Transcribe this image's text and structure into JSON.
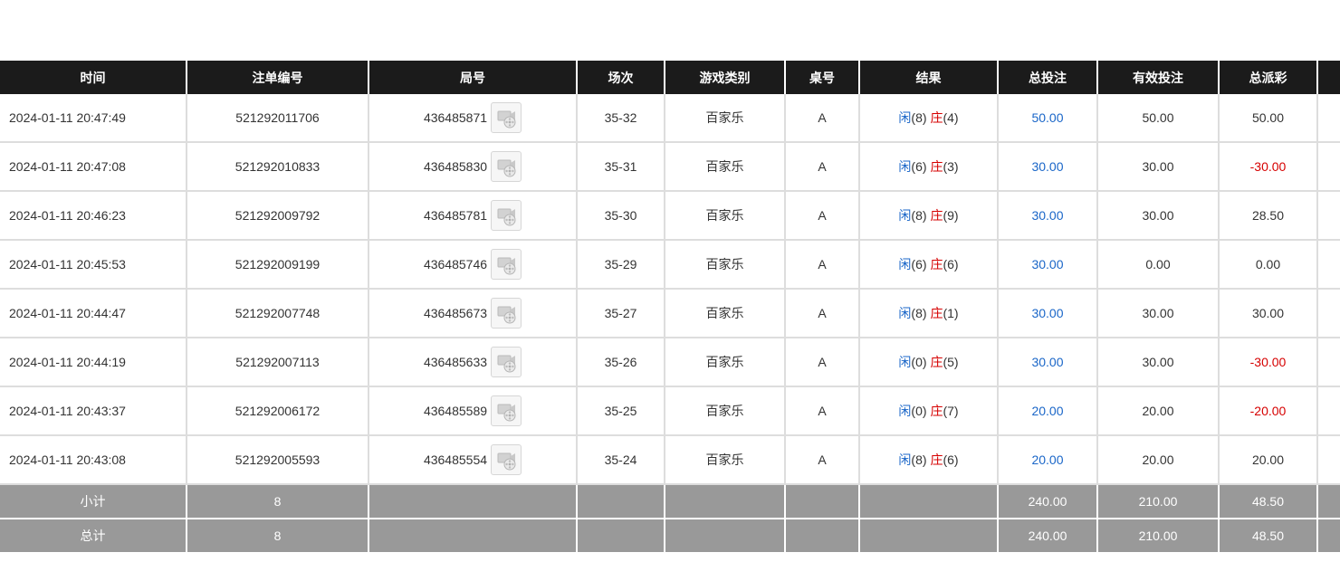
{
  "table": {
    "headers": [
      "时间",
      "注单编号",
      "局号",
      "场次",
      "游戏类别",
      "桌号",
      "结果",
      "总投注",
      "有效投注",
      "总派彩",
      ""
    ],
    "result_labels": {
      "player": "闲",
      "banker": "庄"
    },
    "icons": {
      "replay": "video-replay-icon"
    },
    "colors": {
      "bet_amount": "#1a66c8",
      "negative_payout": "#d60000"
    },
    "rows": [
      {
        "time": "2024-01-11 20:47:49",
        "bet_no": "521292011706",
        "round": "436485871",
        "session": "35-32",
        "game": "百家乐",
        "table_no": "A",
        "player": "(8)",
        "banker": "(4)",
        "total_bet": "50.00",
        "valid_bet": "50.00",
        "payout": "50.00",
        "payout_negative": false
      },
      {
        "time": "2024-01-11 20:47:08",
        "bet_no": "521292010833",
        "round": "436485830",
        "session": "35-31",
        "game": "百家乐",
        "table_no": "A",
        "player": "(6)",
        "banker": "(3)",
        "total_bet": "30.00",
        "valid_bet": "30.00",
        "payout": "-30.00",
        "payout_negative": true
      },
      {
        "time": "2024-01-11 20:46:23",
        "bet_no": "521292009792",
        "round": "436485781",
        "session": "35-30",
        "game": "百家乐",
        "table_no": "A",
        "player": "(8)",
        "banker": "(9)",
        "total_bet": "30.00",
        "valid_bet": "30.00",
        "payout": "28.50",
        "payout_negative": false
      },
      {
        "time": "2024-01-11 20:45:53",
        "bet_no": "521292009199",
        "round": "436485746",
        "session": "35-29",
        "game": "百家乐",
        "table_no": "A",
        "player": "(6)",
        "banker": "(6)",
        "total_bet": "30.00",
        "valid_bet": "0.00",
        "payout": "0.00",
        "payout_negative": false
      },
      {
        "time": "2024-01-11 20:44:47",
        "bet_no": "521292007748",
        "round": "436485673",
        "session": "35-27",
        "game": "百家乐",
        "table_no": "A",
        "player": "(8)",
        "banker": "(1)",
        "total_bet": "30.00",
        "valid_bet": "30.00",
        "payout": "30.00",
        "payout_negative": false
      },
      {
        "time": "2024-01-11 20:44:19",
        "bet_no": "521292007113",
        "round": "436485633",
        "session": "35-26",
        "game": "百家乐",
        "table_no": "A",
        "player": "(0)",
        "banker": "(5)",
        "total_bet": "30.00",
        "valid_bet": "30.00",
        "payout": "-30.00",
        "payout_negative": true
      },
      {
        "time": "2024-01-11 20:43:37",
        "bet_no": "521292006172",
        "round": "436485589",
        "session": "35-25",
        "game": "百家乐",
        "table_no": "A",
        "player": "(0)",
        "banker": "(7)",
        "total_bet": "20.00",
        "valid_bet": "20.00",
        "payout": "-20.00",
        "payout_negative": true
      },
      {
        "time": "2024-01-11 20:43:08",
        "bet_no": "521292005593",
        "round": "436485554",
        "session": "35-24",
        "game": "百家乐",
        "table_no": "A",
        "player": "(8)",
        "banker": "(6)",
        "total_bet": "20.00",
        "valid_bet": "20.00",
        "payout": "20.00",
        "payout_negative": false
      }
    ],
    "subtotal": {
      "label": "小计",
      "count": "8",
      "total_bet": "240.00",
      "valid_bet": "210.00",
      "payout": "48.50"
    },
    "total": {
      "label": "总计",
      "count": "8",
      "total_bet": "240.00",
      "valid_bet": "210.00",
      "payout": "48.50"
    }
  }
}
